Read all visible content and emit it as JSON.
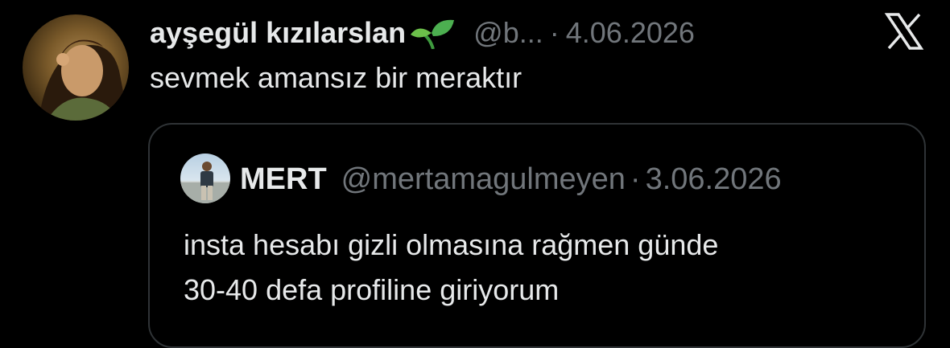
{
  "tweet": {
    "display_name": "ayşegül kızılarslan",
    "badge_icon": "sprout-icon",
    "handle": "@b...",
    "separator": "·",
    "date": "4.06.2026",
    "text": "sevmek amansız bir meraktır",
    "platform_icon": "x-logo-icon"
  },
  "quote": {
    "display_name": "MERT",
    "handle": "@mertamagulmeyen",
    "separator": "·",
    "date": "3.06.2026",
    "text_lines": [
      "insta hesabı gizli olmasına rağmen günde",
      "30-40 defa profiline giriyorum"
    ]
  },
  "colors": {
    "background": "#000000",
    "primary_text": "#e7e9ea",
    "secondary_text": "#71767b",
    "border": "#2f3336",
    "sprout_green": "#4caf50"
  }
}
